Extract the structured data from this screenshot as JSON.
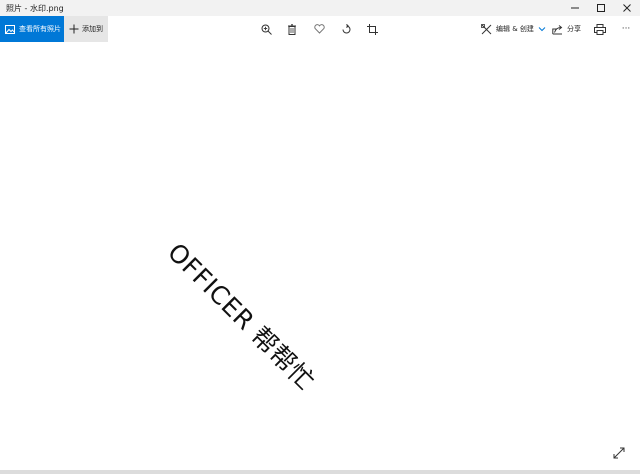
{
  "window": {
    "title": "照片 - 水印.png"
  },
  "toolbar": {
    "view_all_label": "查看所有照片",
    "add_to_label": "添加到",
    "edit_create_label": "编辑 & 创建",
    "share_label": "分享",
    "more_label": "···"
  },
  "canvas": {
    "watermark_text": "OFFICER 帮帮忙"
  },
  "colors": {
    "accent": "#0078d7",
    "titlebar": "#f2f2f2",
    "add_button": "#e6e6e6"
  },
  "icons": [
    "photos-icon",
    "plus-icon",
    "zoom-icon",
    "delete-icon",
    "heart-icon",
    "rotate-icon",
    "crop-icon",
    "edit-create-icon",
    "chevron-down-icon",
    "share-icon",
    "print-icon",
    "more-icon",
    "minimize-icon",
    "maximize-icon",
    "close-icon",
    "expand-icon"
  ]
}
